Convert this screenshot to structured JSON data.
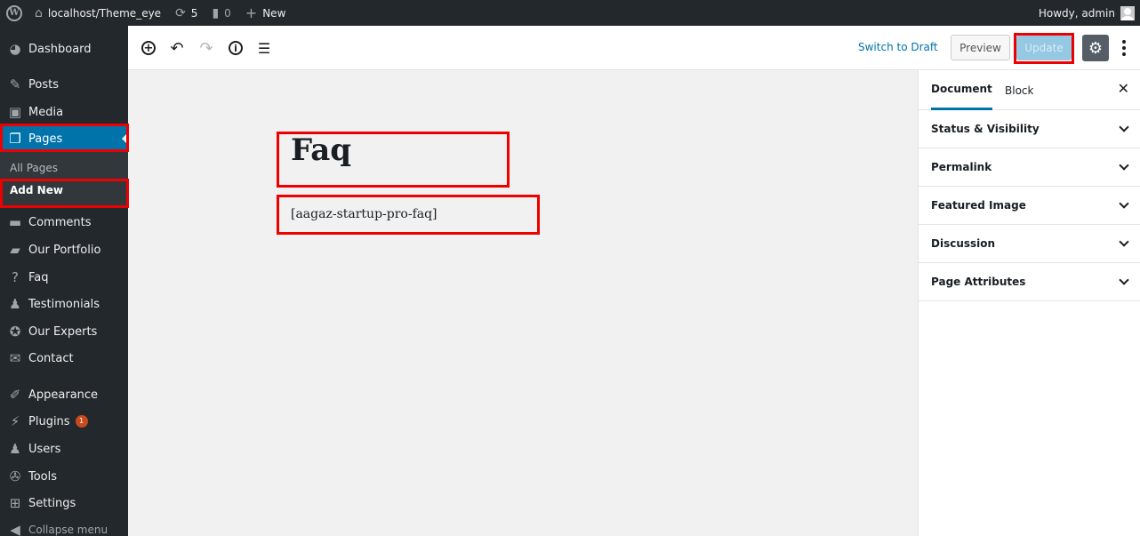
{
  "adminbar": {
    "site_name": "localhost/Theme_eye",
    "updates_count": "5",
    "comments_count": "0",
    "new_label": "New",
    "howdy": "Howdy, admin"
  },
  "menu": {
    "dashboard": "Dashboard",
    "posts": "Posts",
    "media": "Media",
    "pages": "Pages",
    "all_pages": "All Pages",
    "add_new": "Add New",
    "comments": "Comments",
    "our_portfolio": "Our Portfolio",
    "faq": "Faq",
    "testimonials": "Testimonials",
    "our_experts": "Our Experts",
    "contact": "Contact",
    "appearance": "Appearance",
    "plugins": "Plugins",
    "plugins_badge": "1",
    "users": "Users",
    "tools": "Tools",
    "settings": "Settings",
    "collapse": "Collapse menu"
  },
  "toolbar": {
    "switch_to_draft": "Switch to Draft",
    "preview": "Preview",
    "update": "Update"
  },
  "editor": {
    "title": "Faq",
    "content": "[aagaz-startup-pro-faq]"
  },
  "sidebar": {
    "tab_document": "Document",
    "tab_block": "Block",
    "panels": [
      "Status & Visibility",
      "Permalink",
      "Featured Image",
      "Discussion",
      "Page Attributes"
    ]
  },
  "colors": {
    "admin_bg": "#23282d",
    "accent": "#0073aa",
    "highlight": "#ee0000"
  }
}
